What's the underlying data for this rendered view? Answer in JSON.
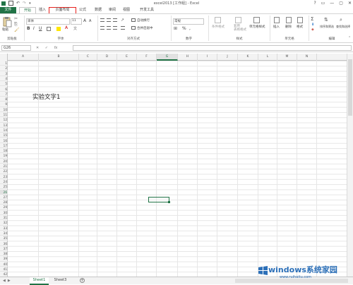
{
  "window": {
    "title": "excel2013 [工作組] - Excel",
    "controls": [
      "?",
      "▭",
      "—",
      "▢",
      "✕"
    ]
  },
  "tabs": [
    "文件",
    "开始",
    "插入",
    "页面布局",
    "公式",
    "数据",
    "审阅",
    "视图",
    "开发工具"
  ],
  "highlighted_tab": "页面布局",
  "ribbon": {
    "clipboard": {
      "paste": "粘贴",
      "label": "剪贴板"
    },
    "font": {
      "name": "宋体",
      "size": "11",
      "bold": "B",
      "italic": "I",
      "underline": "U",
      "grow": "A",
      "shrink": "A",
      "color": "A",
      "wen": "文",
      "label": "字体"
    },
    "alignment": {
      "wrap": "自动换行",
      "merge": "合并后居中",
      "label": "对齐方式"
    },
    "number": {
      "format": "常规",
      "percent": "%",
      "comma": ",",
      "label": "数字"
    },
    "styles": {
      "conditional": "条件格式",
      "table": "套用\n表格格式",
      "cell": "单元格样式",
      "label": "样式"
    },
    "cells": {
      "insert": "插入",
      "delete": "删除",
      "format": "格式",
      "label": "单元格"
    },
    "editing": {
      "sum": "Σ",
      "sort": "排序和筛选",
      "find": "查找和选择",
      "label": "编辑"
    }
  },
  "formula_bar": {
    "name_box": "G26",
    "fx": "fx",
    "content": ""
  },
  "columns": [
    "A",
    "B",
    "C",
    "D",
    "E",
    "F",
    "G",
    "H",
    "I",
    "J",
    "K",
    "L",
    "M",
    "N"
  ],
  "selected_column": "G",
  "rows": [
    "1",
    "2",
    "3",
    "4",
    "5",
    "6",
    "7",
    "8",
    "9",
    "10",
    "11",
    "12",
    "13",
    "14",
    "15",
    "16",
    "17",
    "18",
    "19",
    "20",
    "21",
    "22",
    "23",
    "24",
    "25",
    "26",
    "27",
    "28",
    "29",
    "30",
    "31",
    "32",
    "33",
    "34",
    "35",
    "36",
    "37",
    "38",
    "39",
    "40",
    "41",
    "42"
  ],
  "selected_row": "26",
  "cell_text": "实验文字1",
  "sheets": [
    "Sheet1",
    "Sheet3"
  ],
  "active_sheet": "Sheet1",
  "watermark": {
    "brand": "windows系统家园",
    "url": "www.ruihaitu.com"
  },
  "accent_color": "#217346",
  "highlight_color": "#e8201b"
}
